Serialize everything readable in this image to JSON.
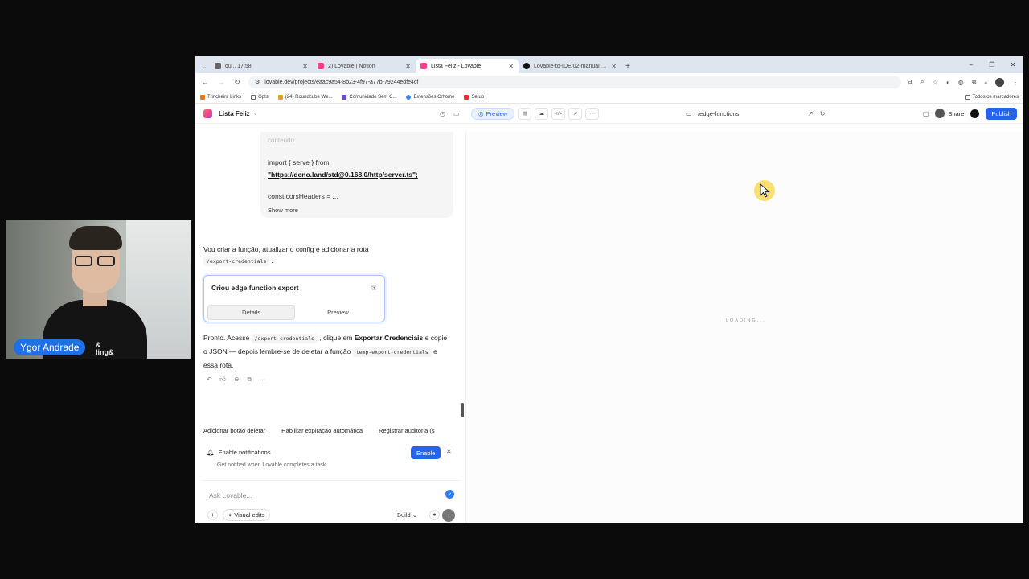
{
  "browser": {
    "tabs": [
      {
        "label": "qui., 17:58",
        "favicon_color": "#666666",
        "active": false
      },
      {
        "label": "2) Lovable | Notion",
        "favicon_color": "#f7418f",
        "active": false
      },
      {
        "label": "Lista Feliz - Lovable",
        "favicon_color": "#f7418f",
        "active": true
      },
      {
        "label": "Lovable-to-IDE/02-manual at m",
        "favicon_color": "#111111",
        "active": false
      }
    ],
    "url": "lovable.dev/projects/eaac9a54-8b23-4f97-a77b-79244edfe4cf",
    "bookmarks": [
      {
        "label": "Trincheira Links",
        "color": "#e07a1f"
      },
      {
        "label": "Gpts",
        "color": "#666666"
      },
      {
        "label": "(24) Roundcube We...",
        "color": "#e0a31f"
      },
      {
        "label": "Comunidade Sem C...",
        "color": "#6c4bd8"
      },
      {
        "label": "Extensões Crhome",
        "color": "#4285f4"
      },
      {
        "label": "Setup",
        "color": "#d33"
      }
    ],
    "bookmarks_right": "Todos os marcadores"
  },
  "app": {
    "project_name": "Lista Feliz",
    "preview_label": "Preview",
    "route": "/edge-functions",
    "share_label": "Share",
    "publish_label": "Publish"
  },
  "chat": {
    "code_card": {
      "faded": "conteúdo:",
      "line1": "import { serve } from",
      "link": "\"https://deno.land/std@0.168.0/http/server.ts\";",
      "line3": "const corsHeaders = ...",
      "show_more": "Show more"
    },
    "message1": "Vou criar a função, atualizar o config e adicionar a rota",
    "message1_code": "/export-credentials",
    "message1_tail": ".",
    "function_card": {
      "title": "Criou edge function export",
      "tab_details": "Details",
      "tab_preview": "Preview"
    },
    "message2": {
      "part1": "Pronto. Acesse",
      "code1": "/export-credentials",
      "part2": ", clique em",
      "bold": "Exportar Credenciais",
      "part3": "e copie o JSON — depois lembre-se de deletar a função",
      "code2": "temp-export-credentials",
      "part4": "e essa rota."
    },
    "suggestions": [
      "Adicionar botão deletar",
      "Habilitar expiração automática",
      "Registrar auditoria (s"
    ],
    "notification": {
      "title": "Enable notifications",
      "subtitle": "Get notified when Lovable completes a task.",
      "enable_label": "Enable"
    },
    "composer": {
      "placeholder": "Ask Lovable...",
      "visual_edits": "Visual edits",
      "build_label": "Build"
    }
  },
  "preview": {
    "loading_text": "LOADING..."
  },
  "webcam": {
    "name": "Ygor Andrade",
    "shirt_text": "&\nling&"
  },
  "colors": {
    "accent": "#2563eb",
    "cursor_halo": "#fad646"
  }
}
